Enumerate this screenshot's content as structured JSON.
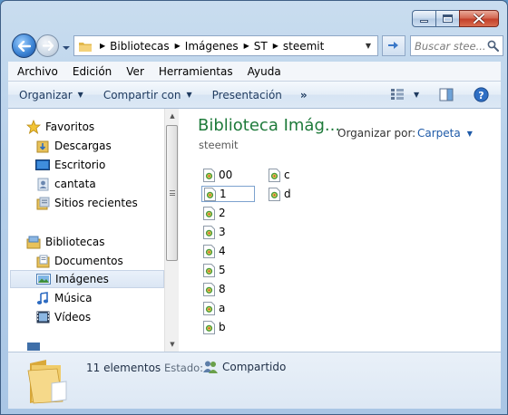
{
  "window": {
    "caption": {
      "minimize": "minimize",
      "maximize": "maximize",
      "close": "close"
    }
  },
  "address": {
    "crumbs": [
      "Bibliotecas",
      "Imágenes",
      "ST",
      "steemit"
    ],
    "search_placeholder": "Buscar stee..."
  },
  "menu": [
    "Archivo",
    "Edición",
    "Ver",
    "Herramientas",
    "Ayuda"
  ],
  "toolbar": {
    "organize": "Organizar",
    "share": "Compartir con",
    "slideshow": "Presentación",
    "more": "»"
  },
  "sidebar": {
    "favorites_header": "Favoritos",
    "favorites": [
      "Descargas",
      "Escritorio",
      "cantata",
      "Sitios recientes"
    ],
    "libraries_header": "Bibliotecas",
    "libraries": [
      "Documentos",
      "Imágenes",
      "Música",
      "Vídeos"
    ],
    "selected": "Imágenes"
  },
  "main": {
    "title": "Biblioteca Imág...",
    "subtitle": "steemit",
    "arrange_label": "Organizar por:",
    "arrange_value": "Carpeta",
    "files_col1": [
      "00",
      "1",
      "2",
      "3",
      "4",
      "5",
      "8",
      "a",
      "b"
    ],
    "files_col2": [
      "c",
      "d"
    ],
    "selected_file": "1"
  },
  "details": {
    "count": "11 elementos",
    "state_label": "Estado:",
    "state_value": "Compartido"
  },
  "colors": {
    "title_green": "#1e7a3a",
    "link_blue": "#1e5aa8",
    "accent": "#3f86d6"
  }
}
